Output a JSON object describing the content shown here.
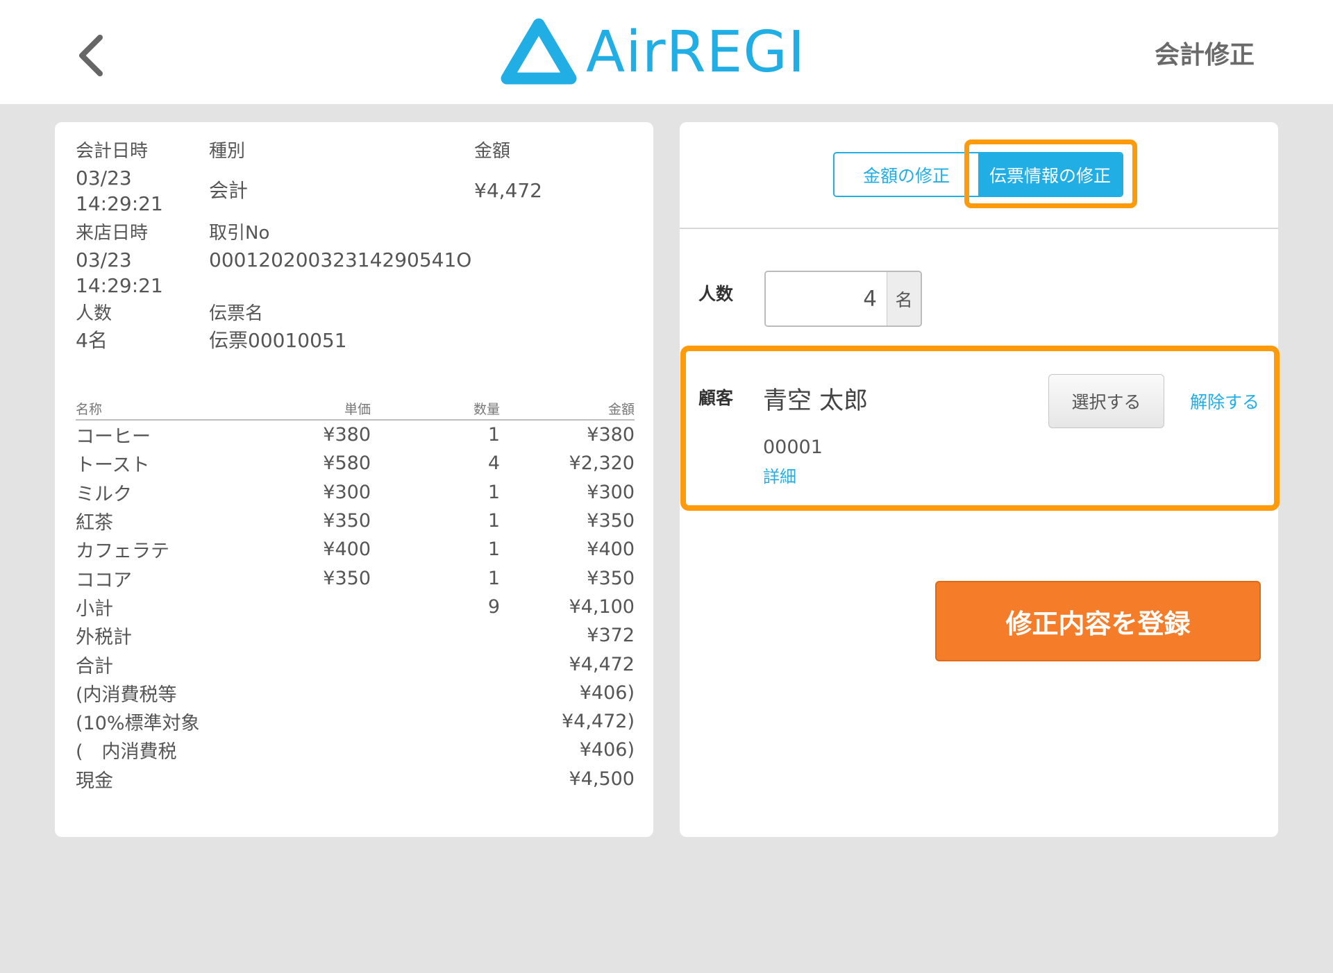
{
  "header": {
    "logo_text": "AirREGI",
    "screen_title": "会計修正"
  },
  "colors": {
    "brand_blue": "#20aee5",
    "highlight_orange": "#ff9a0a",
    "submit_orange": "#f57c28"
  },
  "receipt": {
    "labels": {
      "checkout_datetime": "会計日時",
      "type": "種別",
      "amount": "金額",
      "visit_datetime": "来店日時",
      "transaction_no": "取引No",
      "guests": "人数",
      "slip_name": "伝票名"
    },
    "checkout_date": "03/23",
    "checkout_time": "14:29:21",
    "type_value": "会計",
    "amount_value": "¥4,472",
    "visit_date": "03/23",
    "visit_time": "14:29:21",
    "transaction_no_value": "00012020032314290541O",
    "guests_value": "4名",
    "slip_name_value": "伝票00010051"
  },
  "items_table": {
    "headers": [
      "名称",
      "単価",
      "数量",
      "金額"
    ],
    "rows": [
      {
        "name": "コーヒー",
        "price": "¥380",
        "qty": "1",
        "amount": "¥380"
      },
      {
        "name": "トースト",
        "price": "¥580",
        "qty": "4",
        "amount": "¥2,320"
      },
      {
        "name": "ミルク",
        "price": "¥300",
        "qty": "1",
        "amount": "¥300"
      },
      {
        "name": "紅茶",
        "price": "¥350",
        "qty": "1",
        "amount": "¥350"
      },
      {
        "name": "カフェラテ",
        "price": "¥400",
        "qty": "1",
        "amount": "¥400"
      },
      {
        "name": "ココア",
        "price": "¥350",
        "qty": "1",
        "amount": "¥350"
      },
      {
        "name": "小計",
        "price": "",
        "qty": "9",
        "amount": "¥4,100"
      },
      {
        "name": "外税計",
        "price": "",
        "qty": "",
        "amount": "¥372"
      },
      {
        "name": "合計",
        "price": "",
        "qty": "",
        "amount": "¥4,472"
      },
      {
        "name": "(内消費税等",
        "price": "",
        "qty": "",
        "amount": "¥406)"
      },
      {
        "name": "(10%標準対象",
        "price": "",
        "qty": "",
        "amount": "¥4,472)"
      },
      {
        "name": "(　内消費税",
        "price": "",
        "qty": "",
        "amount": "¥406)"
      },
      {
        "name": "現金",
        "price": "",
        "qty": "",
        "amount": "¥4,500"
      }
    ]
  },
  "edit": {
    "tabs": [
      {
        "label": "金額の修正",
        "active": false
      },
      {
        "label": "伝票情報の修正",
        "active": true
      }
    ],
    "guests_label": "人数",
    "guests_value": "4",
    "guests_unit": "名",
    "customer_label": "顧客",
    "customer_name": "青空 太郎",
    "select_button": "選択する",
    "release_link": "解除する",
    "customer_id": "00001",
    "detail_link": "詳細",
    "submit_button": "修正内容を登録"
  }
}
